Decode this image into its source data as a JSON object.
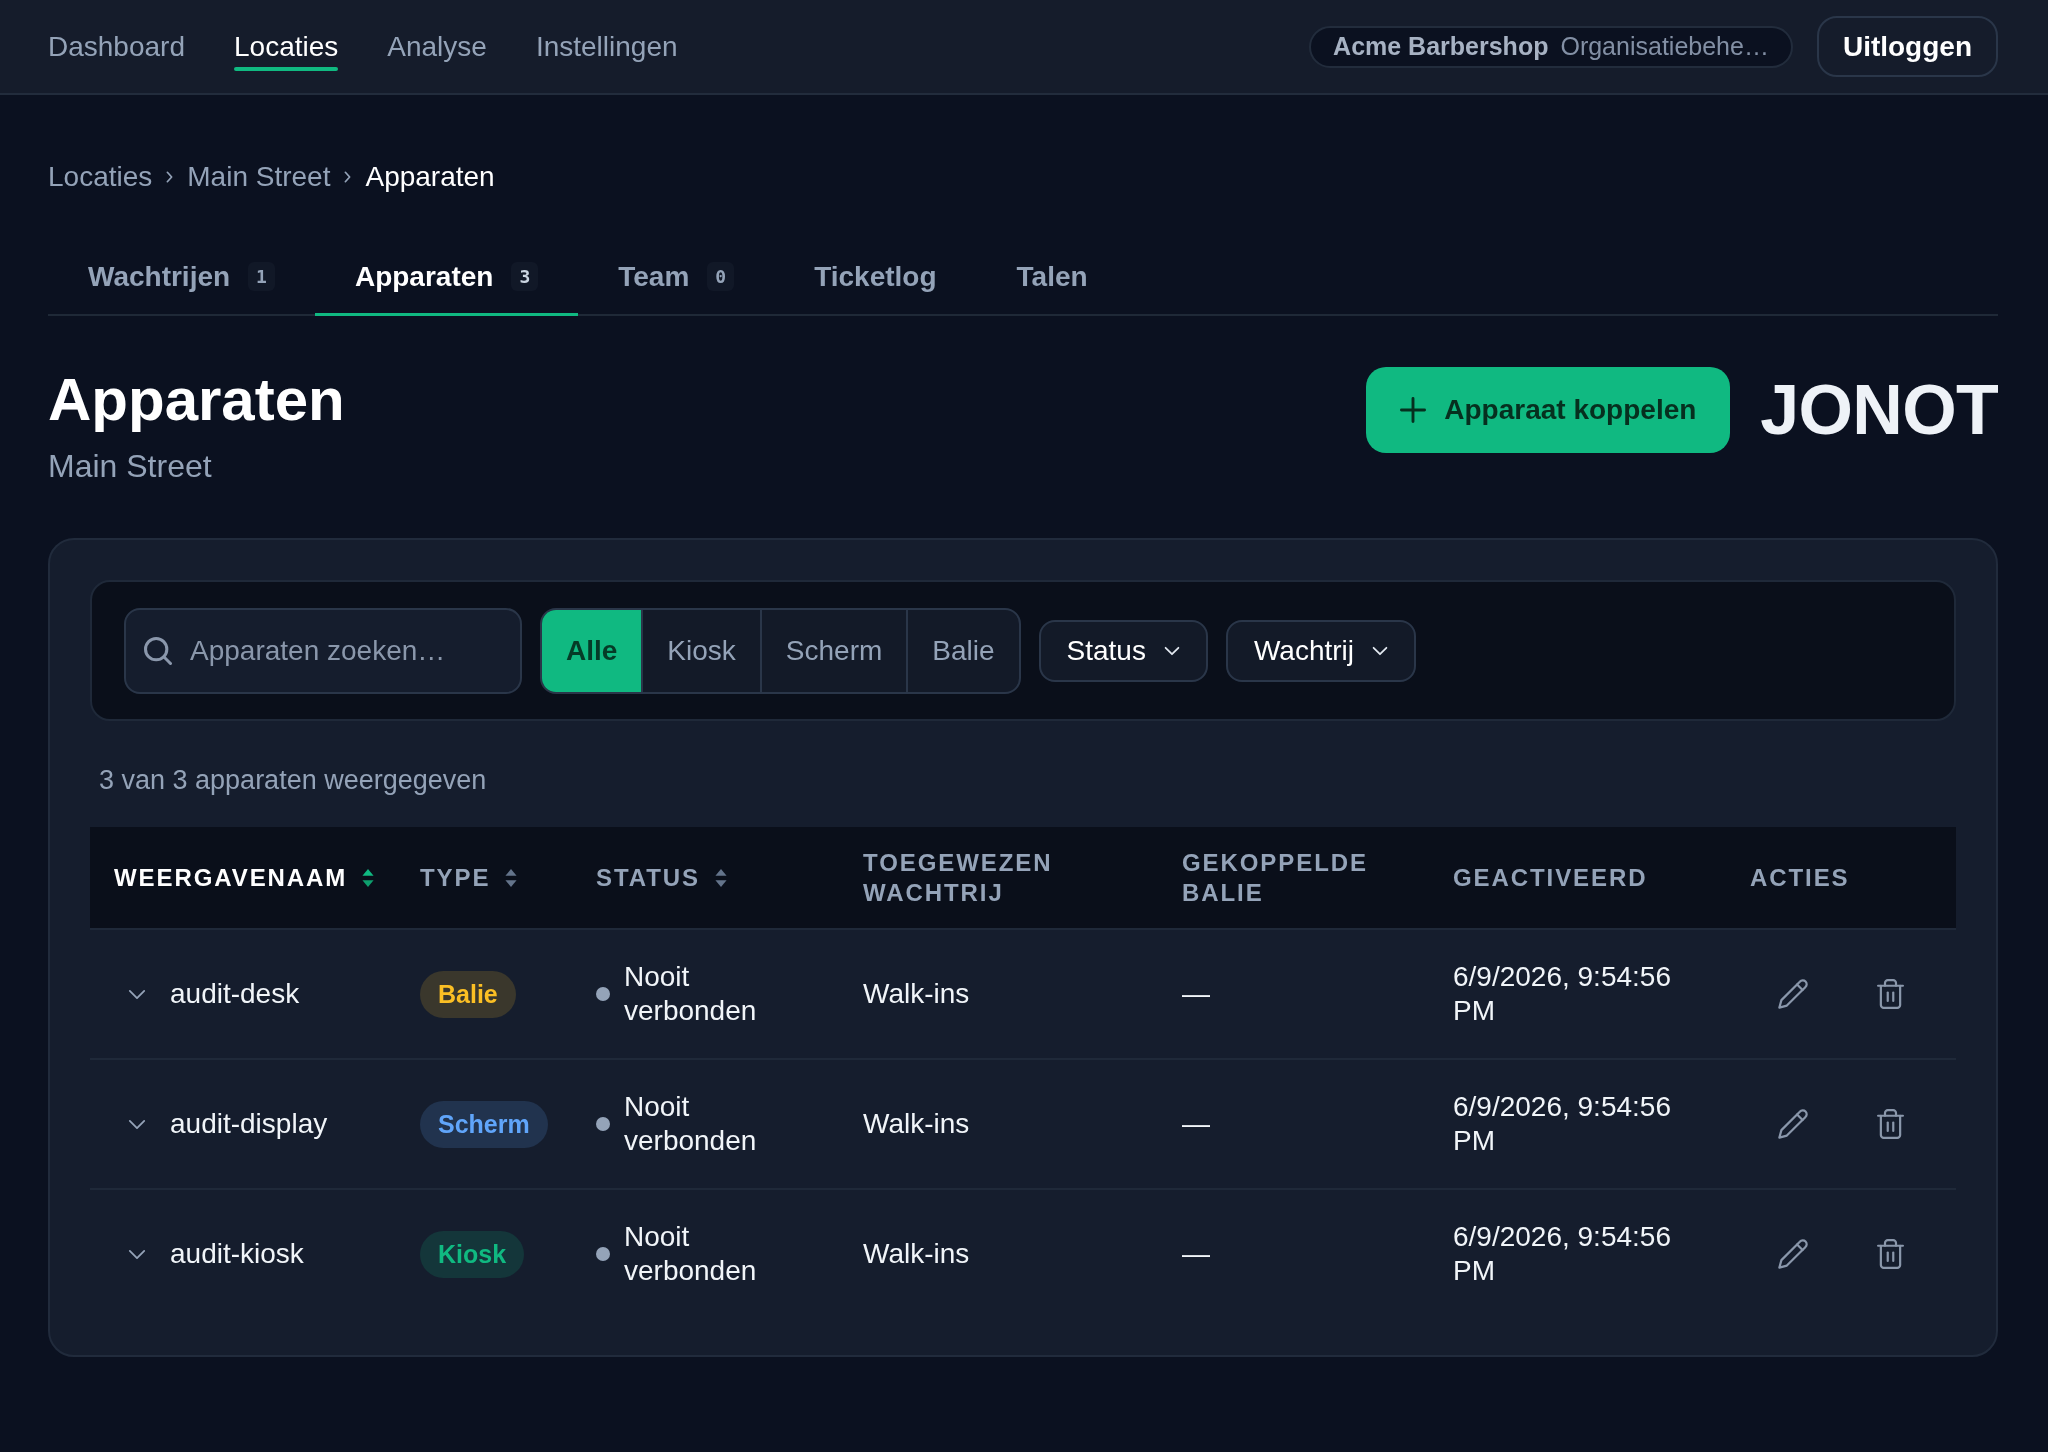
{
  "nav": {
    "items": [
      {
        "label": "Dashboard",
        "selected": false
      },
      {
        "label": "Locaties",
        "selected": true
      },
      {
        "label": "Analyse",
        "selected": false
      },
      {
        "label": "Instellingen",
        "selected": false
      }
    ],
    "organization": {
      "name": "Acme Barbershop",
      "role": "Organisatiebehe…"
    },
    "logout_button": "Uitloggen"
  },
  "breadcrumb": [
    {
      "label": "Locaties",
      "current": false
    },
    {
      "label": "Main Street",
      "current": false
    },
    {
      "label": "Apparaten",
      "current": true
    }
  ],
  "tabs": [
    {
      "label": "Wachtrijen",
      "count": "1",
      "selected": false
    },
    {
      "label": "Apparaten",
      "count": "3",
      "selected": true
    },
    {
      "label": "Team",
      "count": "0",
      "selected": false
    },
    {
      "label": "Ticketlog",
      "selected": false
    },
    {
      "label": "Talen",
      "selected": false
    }
  ],
  "header": {
    "title": "Apparaten",
    "subtitle": "Main Street",
    "add_button": "Apparaat koppelen",
    "logo": "JONOT"
  },
  "filters": {
    "search": {
      "placeholder": "Apparaten zoeken…"
    },
    "type_filter": [
      {
        "label": "Alle",
        "selected": true
      },
      {
        "label": "Kiosk",
        "selected": false
      },
      {
        "label": "Scherm",
        "selected": false
      },
      {
        "label": "Balie",
        "selected": false
      }
    ],
    "dropdowns": [
      "Status",
      "Wachtrij"
    ]
  },
  "result_count": "3 van 3 apparaten weergegeven",
  "table": {
    "columns": [
      {
        "label": "WEERGAVENAAM",
        "sortable": true,
        "sorted": true
      },
      {
        "label": "TYPE",
        "sortable": true,
        "sorted": false
      },
      {
        "label": "STATUS",
        "sortable": true,
        "sorted": false
      },
      {
        "label": "TOEGEWEZEN WACHTRIJ",
        "sortable": false,
        "sorted": false
      },
      {
        "label": "GEKOPPELDE BALIE",
        "sortable": false,
        "sorted": false
      },
      {
        "label": "GEACTIVEERD",
        "sortable": false,
        "sorted": false
      },
      {
        "label": "ACTIES",
        "sortable": false,
        "sorted": false
      }
    ],
    "rows": [
      {
        "expanded": false,
        "name": "audit-desk",
        "type": {
          "label": "Balie",
          "color": "#fbbf24"
        },
        "status": {
          "label": "Nooit verbonden",
          "color": "#94a3b8"
        },
        "queue": "Walk-ins",
        "linked_desk": "—",
        "activated": "6/9/2026, 9:54:56 PM"
      },
      {
        "expanded": false,
        "name": "audit-display",
        "type": {
          "label": "Scherm",
          "color": "#60a5fa"
        },
        "status": {
          "label": "Nooit verbonden",
          "color": "#94a3b8"
        },
        "queue": "Walk-ins",
        "linked_desk": "—",
        "activated": "6/9/2026, 9:54:56 PM"
      },
      {
        "expanded": false,
        "name": "audit-kiosk",
        "type": {
          "label": "Kiosk",
          "color": "#10b981"
        },
        "status": {
          "label": "Nooit verbonden",
          "color": "#94a3b8"
        },
        "queue": "Walk-ins",
        "linked_desk": "—",
        "activated": "6/9/2026, 9:54:56 PM"
      }
    ]
  }
}
